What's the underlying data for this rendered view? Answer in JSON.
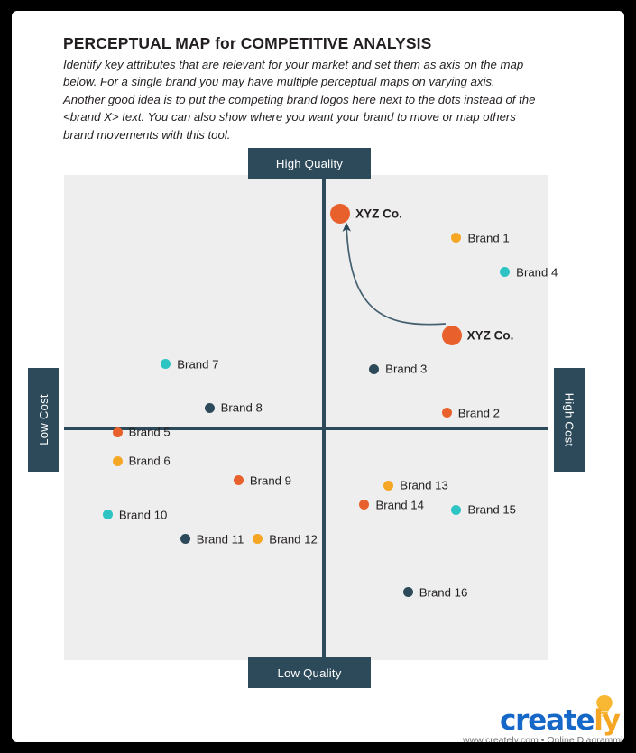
{
  "header": {
    "title": "PERCEPTUAL MAP for COMPETITIVE ANALYSIS",
    "description": "Identify key attributes that are relevant for your market and set them as axis on the map below. For a single brand you may have multiple perceptual maps on varying axis. Another good idea is to put the competing brand logos here next to the dots instead of the <brand X> text. You can also show where you want your brand to move or map others brand movements with this tool."
  },
  "axes": {
    "top": "High Quality",
    "bottom": "Low Quality",
    "left": "Low Cost",
    "right": "High Cost"
  },
  "colors": {
    "axis": "#2d4a5b",
    "plot_background": "#eeeeee",
    "orange": "#e8612c",
    "amber": "#f5a623",
    "teal": "#2ec4c4",
    "navy": "#2d4a5b",
    "logo_blue": "#1668c8",
    "logo_orange": "#f5a623"
  },
  "chart_data": {
    "type": "scatter",
    "title": "PERCEPTUAL MAP for COMPETITIVE ANALYSIS",
    "xlabel": "Cost",
    "ylabel": "Quality",
    "xlim": [
      0,
      100
    ],
    "ylim": [
      0,
      100
    ],
    "grid": false,
    "legend": "none",
    "axis_labels": {
      "x_low": "Low Cost",
      "x_high": "High Cost",
      "y_low": "Low Quality",
      "y_high": "High Quality"
    },
    "annotations": [
      {
        "type": "arrow",
        "label": "brand movement",
        "from": [
          80,
          67
        ],
        "to": [
          57,
          92
        ]
      }
    ],
    "points": [
      {
        "name": "XYZ Co.",
        "x": 57,
        "y": 92,
        "color": "#e8612c",
        "size": "big",
        "label_side": "right"
      },
      {
        "name": "XYZ Co.",
        "x": 80,
        "y": 67,
        "color": "#e8612c",
        "size": "big",
        "label_side": "right"
      },
      {
        "name": "Brand 1",
        "x": 81,
        "y": 87,
        "color": "#f5a623",
        "size": "small",
        "label_side": "right"
      },
      {
        "name": "Brand 4",
        "x": 91,
        "y": 80,
        "color": "#2ec4c4",
        "size": "small",
        "label_side": "right"
      },
      {
        "name": "Brand 3",
        "x": 64,
        "y": 60,
        "color": "#2d4a5b",
        "size": "small",
        "label_side": "right"
      },
      {
        "name": "Brand 2",
        "x": 79,
        "y": 51,
        "color": "#e8612c",
        "size": "small",
        "label_side": "right"
      },
      {
        "name": "Brand 7",
        "x": 21,
        "y": 61,
        "color": "#2ec4c4",
        "size": "small",
        "label_side": "right"
      },
      {
        "name": "Brand 8",
        "x": 30,
        "y": 52,
        "color": "#2d4a5b",
        "size": "small",
        "label_side": "right"
      },
      {
        "name": "Brand 5",
        "x": 11,
        "y": 47,
        "color": "#e8612c",
        "size": "small",
        "label_side": "right"
      },
      {
        "name": "Brand 6",
        "x": 11,
        "y": 41,
        "color": "#f5a623",
        "size": "small",
        "label_side": "right"
      },
      {
        "name": "Brand 9",
        "x": 36,
        "y": 37,
        "color": "#e8612c",
        "size": "small",
        "label_side": "right"
      },
      {
        "name": "Brand 13",
        "x": 67,
        "y": 36,
        "color": "#f5a623",
        "size": "small",
        "label_side": "right"
      },
      {
        "name": "Brand 14",
        "x": 62,
        "y": 32,
        "color": "#e8612c",
        "size": "small",
        "label_side": "right"
      },
      {
        "name": "Brand 15",
        "x": 81,
        "y": 31,
        "color": "#2ec4c4",
        "size": "small",
        "label_side": "right"
      },
      {
        "name": "Brand 10",
        "x": 9,
        "y": 30,
        "color": "#2ec4c4",
        "size": "small",
        "label_side": "right"
      },
      {
        "name": "Brand 11",
        "x": 25,
        "y": 25,
        "color": "#2d4a5b",
        "size": "small",
        "label_side": "right"
      },
      {
        "name": "Brand 12",
        "x": 40,
        "y": 25,
        "color": "#f5a623",
        "size": "small",
        "label_side": "right"
      },
      {
        "name": "Brand 16",
        "x": 71,
        "y": 14,
        "color": "#2d4a5b",
        "size": "small",
        "label_side": "right"
      }
    ]
  },
  "footer": {
    "logo_part1": "creat",
    "logo_part2": "e",
    "logo_part3": "ly",
    "tagline": "www.creately.com • Online Diagramming"
  }
}
